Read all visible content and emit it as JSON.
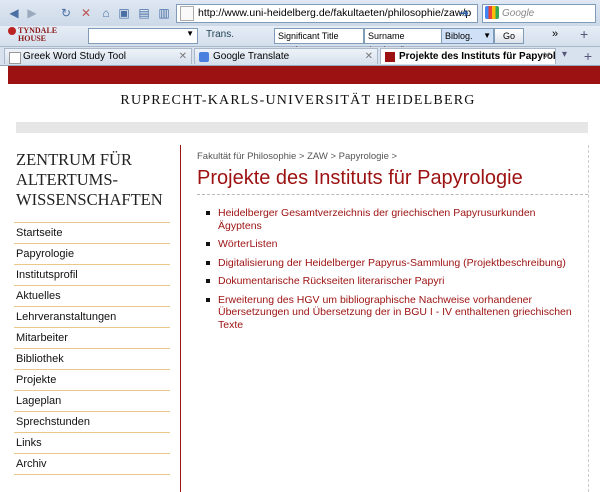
{
  "browser": {
    "url": "http://www.uni-heidelberg.de/fakultaeten/philosophie/zaw/p",
    "search_placeholder": "Google",
    "toolbar": {
      "tyndale_line1": "TYNDALE",
      "tyndale_line2": "HOUSE",
      "trans_label": "Trans.",
      "significant_title_words": "Significant Title words",
      "surname_field": "Surname (optional)",
      "bibliog_select": "Biblog.",
      "go_button": "Go"
    },
    "tabs": [
      {
        "label": "Greek Word Study Tool"
      },
      {
        "label": "Google Translate"
      },
      {
        "label": "Projekte des Instituts für Papyrol..."
      }
    ]
  },
  "page": {
    "university": "RUPRECHT-KARLS-UNIVERSITÄT HEIDELBERG",
    "center_title_line1": "ZENTRUM FÜR",
    "center_title_line2": "ALTERTUMS-",
    "center_title_line3": "WISSENSCHAFTEN",
    "nav": [
      "Startseite",
      "Papyrologie",
      "Institutsprofil",
      "Aktuelles",
      "Lehrveranstaltungen",
      "Mitarbeiter",
      "Bibliothek",
      "Projekte",
      "Lageplan",
      "Sprechstunden",
      "Links",
      "Archiv"
    ],
    "breadcrumb": "Fakultät für Philosophie > ZAW > Papyrologie >",
    "heading": "Projekte des Instituts für Papyrologie",
    "projects": [
      "Heidelberger Gesamtverzeichnis der griechischen Papyrusurkunden Ägyptens",
      "WörterListen",
      "Digitalisierung der Heidelberger Papyrus-Sammlung (Projektbeschreibung)",
      "Dokumentarische Rückseiten literarischer Papyri",
      "Erweiterung des HGV um bibliographische Nachweise vorhandener Übersetzungen und Übersetzung der in BGU I - IV enthaltenen griechischen Texte"
    ]
  },
  "colors": {
    "accent_red": "#9c1111",
    "nav_rule": "#e9c88a"
  }
}
